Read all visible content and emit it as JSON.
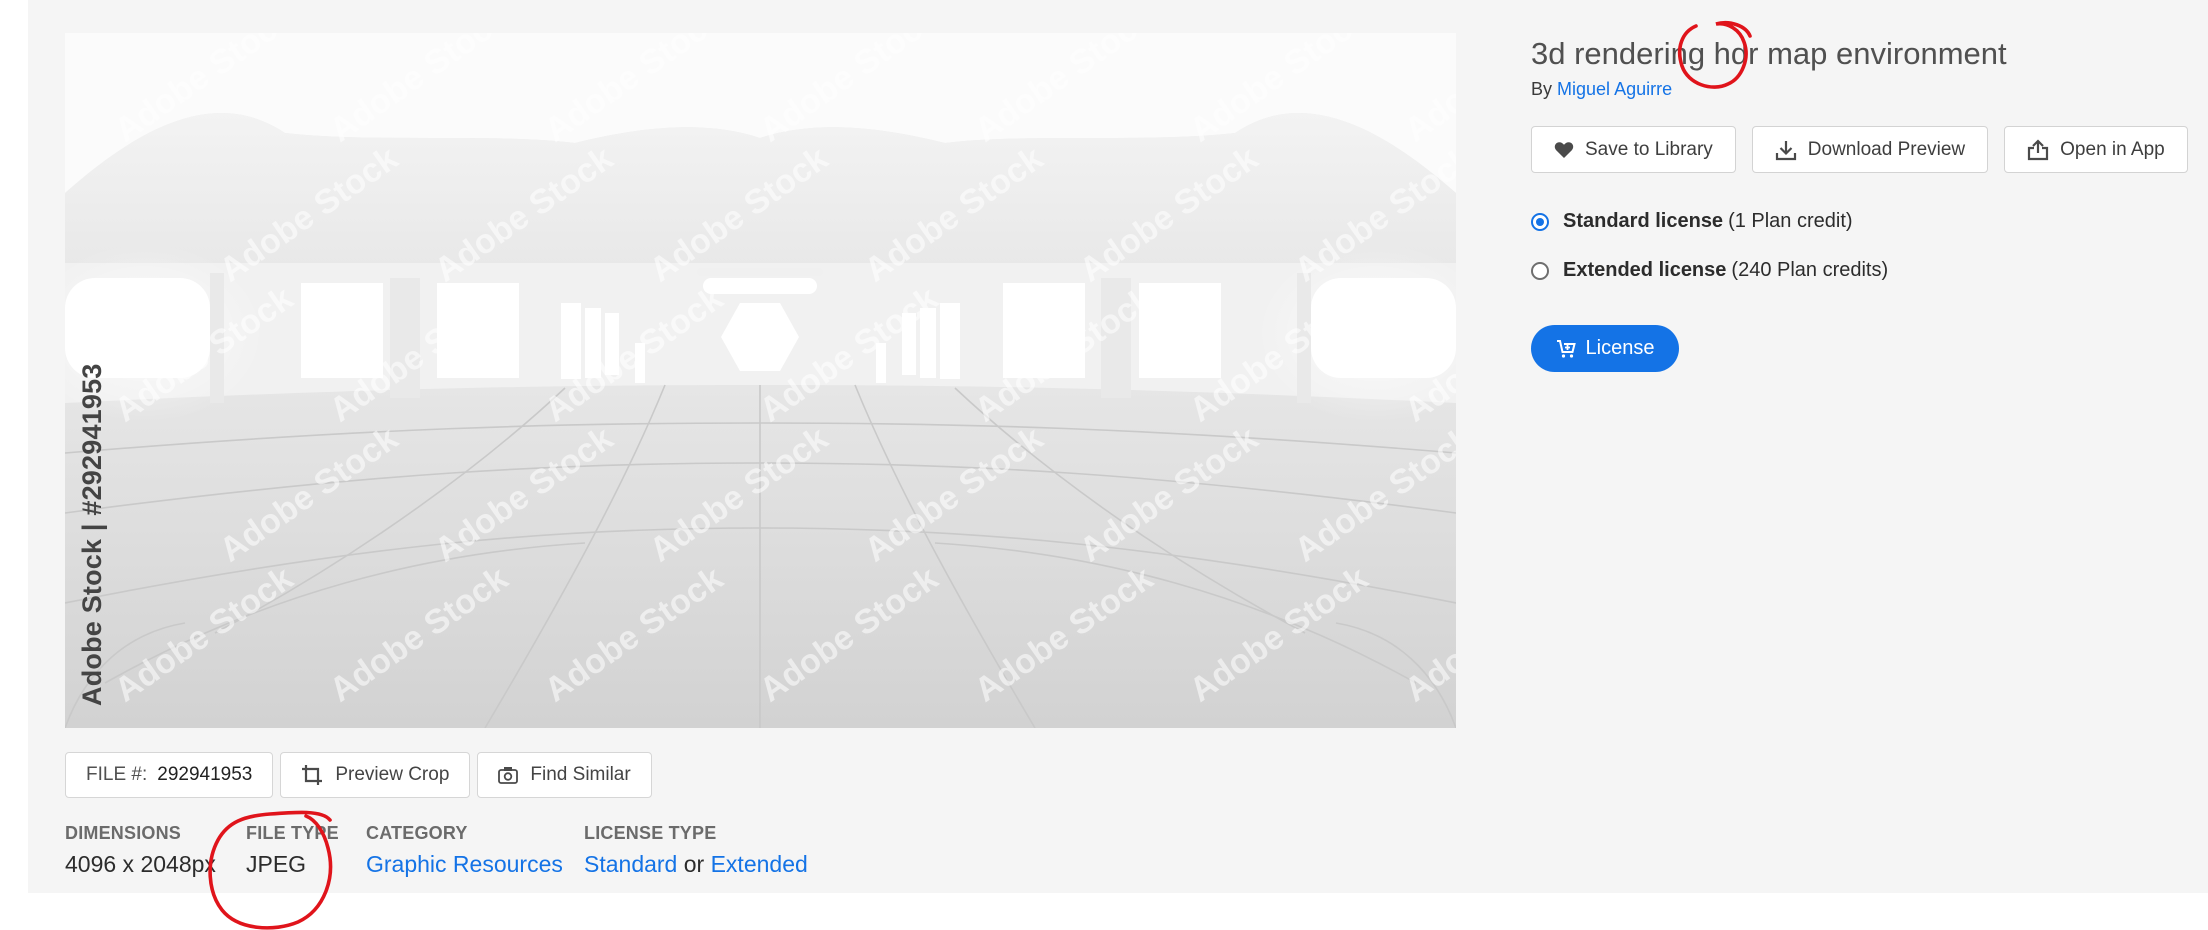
{
  "asset": {
    "title": "3d rendering hdr map environment",
    "by_label": "By",
    "author": "Miguel Aguirre",
    "watermark_text": "Adobe Stock",
    "vertical_watermark": "Adobe Stock | #292941953"
  },
  "actions": {
    "save_to_library": "Save to Library",
    "download_preview": "Download Preview",
    "open_in_app": "Open in App"
  },
  "licenses": [
    {
      "name": "Standard license",
      "detail": "(1 Plan credit)",
      "selected": true
    },
    {
      "name": "Extended license",
      "detail": "(240 Plan credits)",
      "selected": false
    }
  ],
  "license_button": "License",
  "file_bar": {
    "file_label": "FILE #:",
    "file_number": "292941953",
    "preview_crop": "Preview Crop",
    "find_similar": "Find Similar"
  },
  "meta": {
    "dimensions": {
      "label": "DIMENSIONS",
      "value": "4096 x 2048px"
    },
    "file_type": {
      "label": "FILE TYPE",
      "value": "JPEG"
    },
    "category": {
      "label": "CATEGORY",
      "value": "Graphic Resources"
    },
    "license_type": {
      "label": "LICENSE TYPE",
      "standard": "Standard",
      "or": "or",
      "extended": "Extended"
    }
  },
  "colors": {
    "accent": "#1473e6",
    "annotation": "#e0141b",
    "panel_bg": "#f5f5f5"
  },
  "icons": [
    "heart-icon",
    "download-icon",
    "share-icon",
    "crop-icon",
    "camera-icon",
    "cart-icon"
  ]
}
